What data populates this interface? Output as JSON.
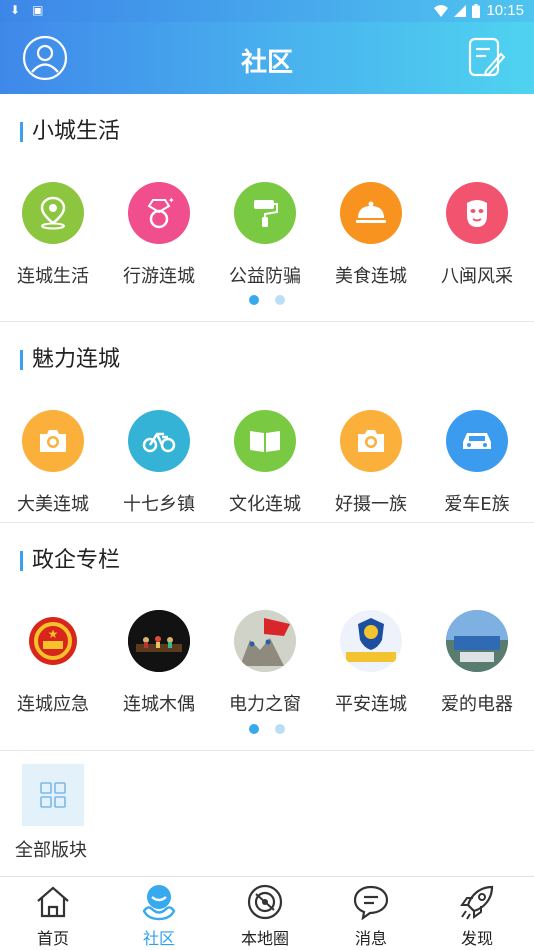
{
  "status_bar": {
    "time": "10:15"
  },
  "header": {
    "title": "社区"
  },
  "sections": [
    {
      "title": "小城生活",
      "items": [
        {
          "label": "连城生活",
          "icon": "location-pin-icon",
          "color": "#8cc63e"
        },
        {
          "label": "行游连城",
          "icon": "gem-ring-icon",
          "color": "#f04e8c"
        },
        {
          "label": "公益防骗",
          "icon": "paint-roller-icon",
          "color": "#7ac943"
        },
        {
          "label": "美食连城",
          "icon": "food-cloche-icon",
          "color": "#f7931e"
        },
        {
          "label": "八闽风采",
          "icon": "face-mask-icon",
          "color": "#f2536e"
        }
      ]
    },
    {
      "title": "魅力连城",
      "items": [
        {
          "label": "大美连城",
          "icon": "camera-icon",
          "color": "#fbb03b"
        },
        {
          "label": "十七乡镇",
          "icon": "bicycle-icon",
          "color": "#35b3d6"
        },
        {
          "label": "文化连城",
          "icon": "book-icon",
          "color": "#7ac943"
        },
        {
          "label": "好摄一族",
          "icon": "camera-icon",
          "color": "#fbb03b"
        },
        {
          "label": "爱车E族",
          "icon": "car-icon",
          "color": "#3a9bef"
        }
      ]
    },
    {
      "title": "政企专栏",
      "items": [
        {
          "label": "连城应急",
          "icon": "national-emblem-icon"
        },
        {
          "label": "连城木偶",
          "icon": "puppet-stage-photo"
        },
        {
          "label": "电力之窗",
          "icon": "power-flag-photo"
        },
        {
          "label": "平安连城",
          "icon": "police-badge-icon"
        },
        {
          "label": "爱的电器",
          "icon": "factory-photo"
        }
      ]
    }
  ],
  "all_blocks": {
    "label": "全部版块"
  },
  "tabbar": [
    {
      "label": "首页",
      "icon": "home-icon",
      "active": false
    },
    {
      "label": "社区",
      "icon": "community-icon",
      "active": true
    },
    {
      "label": "本地圈",
      "icon": "local-circle-icon",
      "active": false
    },
    {
      "label": "消息",
      "icon": "message-icon",
      "active": false
    },
    {
      "label": "发现",
      "icon": "rocket-icon",
      "active": false
    }
  ],
  "colors": {
    "accent": "#36a9ef",
    "header_start": "#3f88ea",
    "header_end": "#4fd3f0"
  }
}
